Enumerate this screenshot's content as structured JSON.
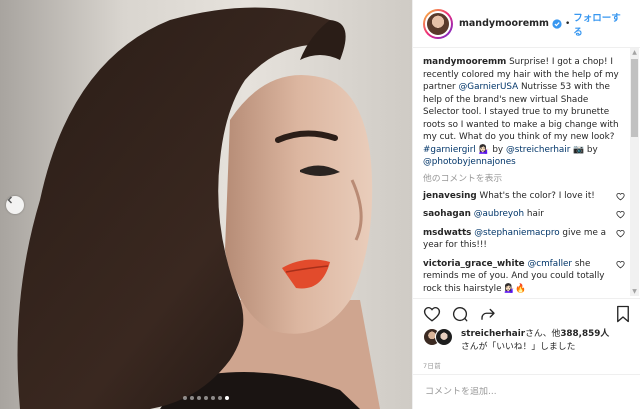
{
  "post": {
    "username": "mandymooremm",
    "follow_label": "フォローする",
    "separator": "•",
    "caption": {
      "user": "mandymooremm",
      "part1": "Surprise! I got a chop! I recently colored my hair with the help of my partner ",
      "mention1": "@GarnierUSA",
      "part2": " Nutrisse 53 with the help of the brand's new virtual Shade Selector tool. I stayed true to my brunette roots so I wanted to make a big change with my cut. What do you think of my new look? ",
      "hashtag": "#garniergirl",
      "part3": " 💁🏻‍♀️ by ",
      "mention2": "@streicherhair",
      "part4": " 📷 by ",
      "mention3": "@photobyjennajones"
    },
    "more_comments_label": "他のコメントを表示",
    "comments": [
      {
        "user": "jenavesing",
        "mention": "",
        "text": "What's the color? I love it!"
      },
      {
        "user": "saohagan",
        "mention": "@aubreyoh",
        "text": " hair"
      },
      {
        "user": "msdwatts",
        "mention": "@stephaniemacpro",
        "text": " give me a year for this!!!"
      },
      {
        "user": "victoria_grace_white",
        "mention": "@cmfaller",
        "text": " she reminds me of you. And you could totally rock this hairstyle 💁🏻‍♀️🔥"
      }
    ],
    "likes": {
      "user": "streicherhair",
      "text1": "さん、他",
      "count": "388,859人",
      "text2": "さんが「いいね！」しました"
    },
    "time": "7日前",
    "add_comment_placeholder": "コメントを追加...",
    "carousel": {
      "count": 7,
      "active_index": 6
    },
    "colors": {
      "link": "#003569",
      "follow": "#3897f0",
      "muted": "#999999",
      "verified": "#3897f0"
    },
    "icons": [
      "chevron-left-icon",
      "verified-badge-icon",
      "heart-icon",
      "comment-icon",
      "share-icon",
      "bookmark-icon"
    ]
  }
}
